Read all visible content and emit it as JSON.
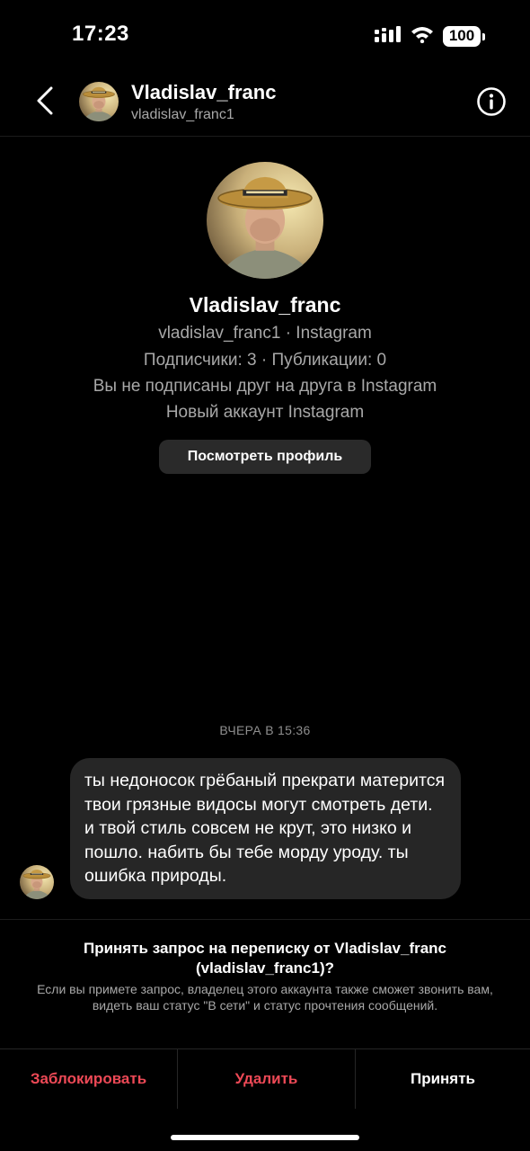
{
  "status_bar": {
    "time": "17:23",
    "battery": "100",
    "icons": [
      "signal-icon",
      "wifi-icon",
      "battery-icon"
    ]
  },
  "header": {
    "name": "Vladislav_franc",
    "username": "vladislav_franc1",
    "icons": [
      "back-chevron-icon",
      "info-icon"
    ]
  },
  "profile": {
    "name": "Vladislav_franc",
    "handle_line": "vladislav_franc1 · Instagram",
    "stats_line": "Подписчики: 3 · Публикации: 0",
    "mutual_line": "Вы не подписаны друг на друга в Instagram",
    "new_account_line": "Новый аккаунт Instagram",
    "view_profile_label": "Посмотреть профиль"
  },
  "conversation": {
    "timestamp": "ВЧЕРА В 15:36",
    "messages": [
      {
        "text": "ты недоносок грёбаный прекрати матерится твои грязные видосы могут смотреть дети. и твой стиль совсем не крут, это низко и пошло. набить бы тебе морду уроду. ты ошибка природы."
      }
    ]
  },
  "request": {
    "title": "Принять запрос на переписку от Vladislav_franc (vladislav_franc1)?",
    "description": "Если вы примете запрос, владелец этого аккаунта также сможет звонить вам, видеть ваш статус \"В сети\" и статус прочтения сообщений."
  },
  "actions": {
    "block": "Заблокировать",
    "delete": "Удалить",
    "accept": "Принять"
  },
  "colors": {
    "background": "#000000",
    "bubble": "#262626",
    "danger": "#ed4956",
    "secondary_text": "#a8a8a8",
    "button_bg": "#2a2a2a"
  }
}
